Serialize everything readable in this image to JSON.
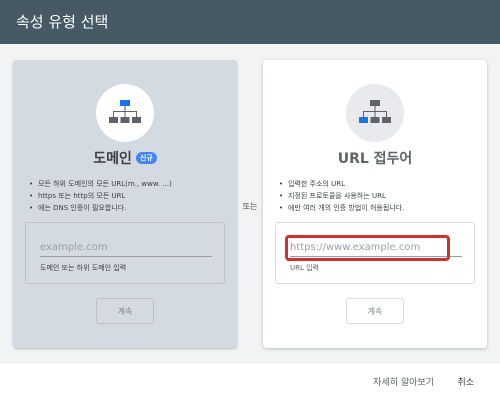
{
  "dialog": {
    "title": "속성 유형 선택"
  },
  "domain_card": {
    "title": "도메인",
    "badge": "신규",
    "bullets": [
      "모든 하위 도메인의 모든 URL(m., www. ...)",
      "https 또는 http의 모든 URL",
      "에는 DNS 인증이 필요합니다."
    ],
    "input_placeholder": "example.com",
    "input_hint": "도메인 또는 하위 도메인 입력",
    "continue_label": "계속"
  },
  "separator": "또는",
  "url_prefix_card": {
    "title": "URL 접두어",
    "bullets": [
      "입력한 주소의 URL",
      "지정된 프로토콜을 사용하는 URL",
      "에만 여러 개의 인증 방법이 허용됩니다."
    ],
    "input_placeholder": "https://www.example.com",
    "input_hint": "URL 입력",
    "continue_label": "계속"
  },
  "footer": {
    "learn_more": "자세히 알아보기",
    "cancel": "취소"
  },
  "colors": {
    "header": "#455a64",
    "highlight": "#d32f2f",
    "badge": "#4285f4"
  },
  "icons": {
    "domain": "sitemap-icon",
    "url_prefix": "sitemap-icon"
  }
}
